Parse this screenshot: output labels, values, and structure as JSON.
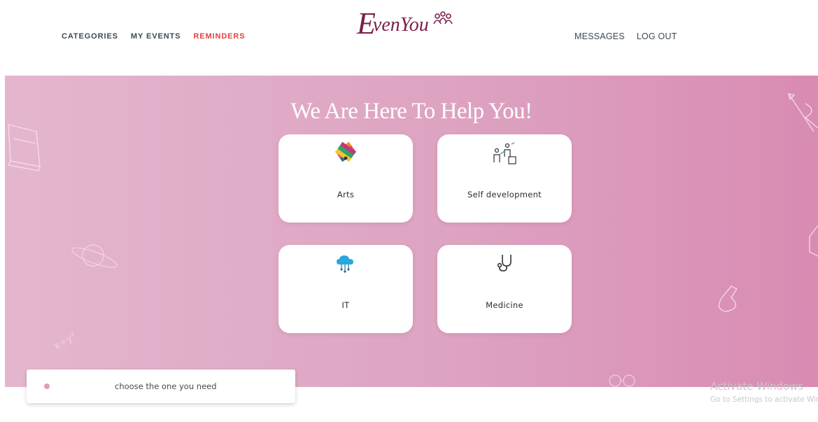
{
  "header": {
    "nav_left": [
      "CATEGORIES",
      "MY EVENTS",
      "REMINDERS"
    ],
    "logo_text_first": "E",
    "logo_text_rest": "venYou",
    "nav_right": [
      "MESSAGES",
      "LOG OUT"
    ]
  },
  "hero": {
    "title": "We Are Here To Help You!",
    "cards": [
      {
        "label": "Arts",
        "icon": "palette-swatch-icon"
      },
      {
        "label": "Self development",
        "icon": "presentation-people-icon"
      },
      {
        "label": "IT",
        "icon": "cloud-network-icon"
      },
      {
        "label": "Medicine",
        "icon": "stethoscope-icon"
      }
    ]
  },
  "hint": {
    "text": "choose the one you need"
  },
  "watermark": {
    "line1": "Activate Windows",
    "line2": "Go to Settings to activate Windows."
  },
  "colors": {
    "accent_red": "#e0423c",
    "brand_purple": "#7a1f4e",
    "hero_pink": "#dda3c1"
  }
}
